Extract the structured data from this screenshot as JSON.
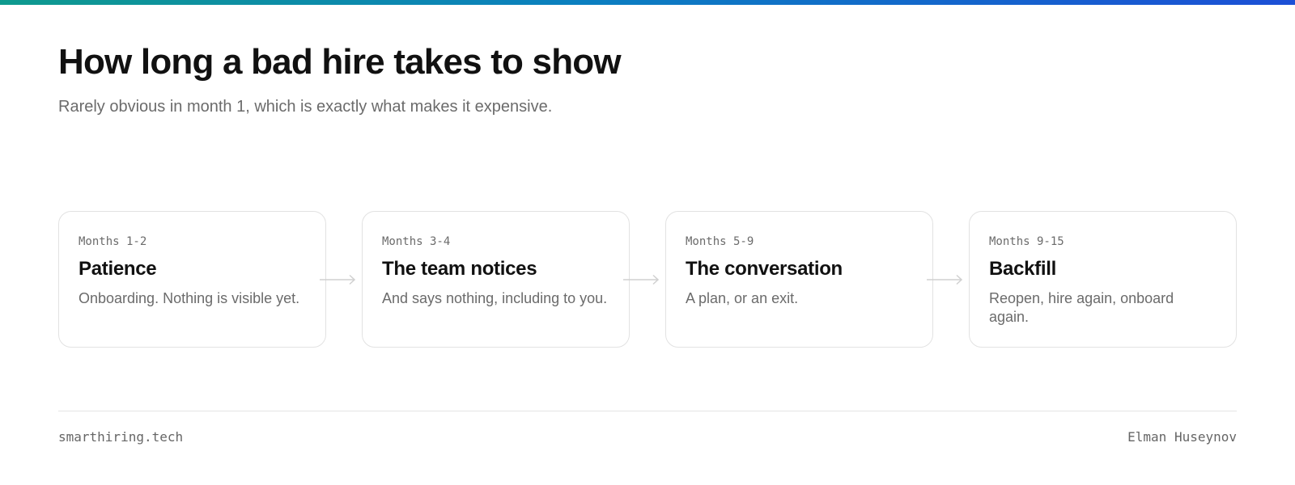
{
  "header": {
    "title": "How long a bad hire takes to show",
    "subtitle": "Rarely obvious in month 1, which is exactly what makes it expensive."
  },
  "steps": [
    {
      "period": "Months 1-2",
      "title": "Patience",
      "description": "Onboarding. Nothing is visible yet."
    },
    {
      "period": "Months 3-4",
      "title": "The team notices",
      "description": "And says nothing, including to you."
    },
    {
      "period": "Months 5-9",
      "title": "The conversation",
      "description": "A plan, or an exit."
    },
    {
      "period": "Months 9-15",
      "title": "Backfill",
      "description": "Reopen, hire again, onboard again."
    }
  ],
  "footer": {
    "site": "smarthiring.tech",
    "author": "Elman Huseynov"
  },
  "colors": {
    "accent_gradient": [
      "#0e9a8e",
      "#0b7fc0",
      "#1c4fd6"
    ],
    "text_primary": "#111111",
    "text_muted": "#6b6b6b",
    "border": "#e2e2e2",
    "connector": "#d0d0d0"
  }
}
